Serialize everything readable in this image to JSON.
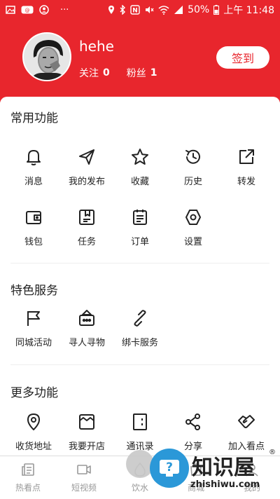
{
  "status_bar": {
    "dots": "···",
    "battery": "50%",
    "time": "上午 11:48"
  },
  "profile": {
    "username": "hehe",
    "following_label": "关注",
    "following_count": "0",
    "fans_label": "粉丝",
    "fans_count": "1",
    "signin_label": "签到"
  },
  "common": {
    "title": "常用功能",
    "items": [
      {
        "label": "消息",
        "icon": "bell-icon"
      },
      {
        "label": "我的发布",
        "icon": "send-icon"
      },
      {
        "label": "收藏",
        "icon": "star-icon"
      },
      {
        "label": "历史",
        "icon": "history-icon"
      },
      {
        "label": "转发",
        "icon": "share-out-icon"
      },
      {
        "label": "钱包",
        "icon": "wallet-icon"
      },
      {
        "label": "任务",
        "icon": "task-icon"
      },
      {
        "label": "订单",
        "icon": "order-icon"
      },
      {
        "label": "设置",
        "icon": "settings-icon"
      }
    ]
  },
  "special": {
    "title": "特色服务",
    "items": [
      {
        "label": "同城活动",
        "icon": "flag-icon"
      },
      {
        "label": "寻人寻物",
        "icon": "search-person-icon"
      },
      {
        "label": "绑卡服务",
        "icon": "link-icon"
      }
    ]
  },
  "more": {
    "title": "更多功能",
    "items": [
      {
        "label": "收货地址",
        "icon": "location-icon"
      },
      {
        "label": "我要开店",
        "icon": "shop-icon"
      },
      {
        "label": "通讯录",
        "icon": "contacts-icon"
      },
      {
        "label": "分享",
        "icon": "share-icon"
      },
      {
        "label": "加入看点",
        "icon": "handshake-icon"
      }
    ]
  },
  "tabbar": {
    "items": [
      {
        "label": "热看点",
        "icon": "news-icon"
      },
      {
        "label": "短视频",
        "icon": "video-icon"
      },
      {
        "label": "饮水",
        "icon": "water-icon"
      },
      {
        "label": "商城",
        "icon": "mall-icon"
      },
      {
        "label": "我的",
        "icon": "me-icon"
      }
    ]
  },
  "watermark": {
    "brand": "知识屋",
    "url": "zhishiwu.com",
    "reg": "®"
  },
  "colors": {
    "brand_red": "#e8262d",
    "watermark_blue": "#2b98d8"
  }
}
